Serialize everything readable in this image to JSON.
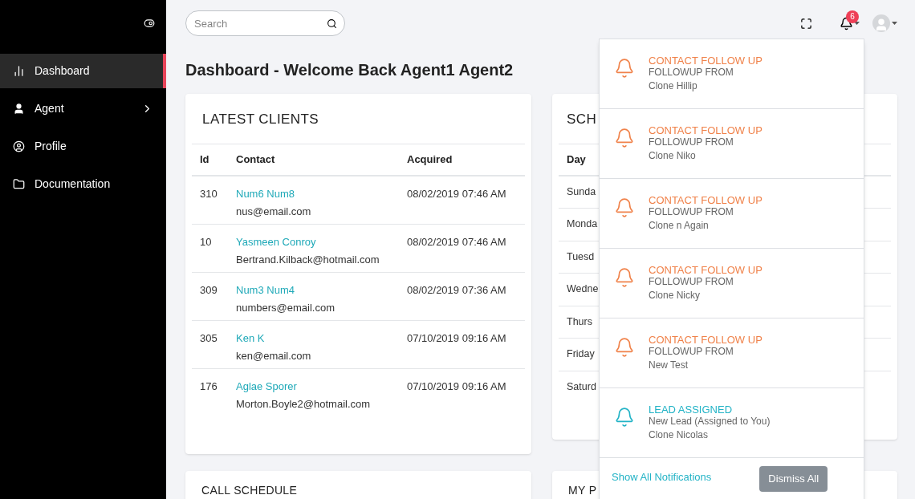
{
  "sidebar": {
    "items": [
      {
        "label": "Dashboard",
        "selected": true,
        "has_children": false
      },
      {
        "label": "Agent",
        "selected": false,
        "has_children": true
      },
      {
        "label": "Profile",
        "selected": false,
        "has_children": false
      },
      {
        "label": "Documentation",
        "selected": false,
        "has_children": false
      }
    ]
  },
  "header": {
    "search": {
      "placeholder": "Search"
    },
    "notification_count": "6"
  },
  "page_title": "Dashboard - Welcome Back Agent1 Agent2",
  "latest_clients": {
    "title": "LATEST CLIENTS",
    "columns": [
      "Id",
      "Contact",
      "Acquired"
    ],
    "rows": [
      {
        "id": "310",
        "name": "Num6 Num8",
        "email": "nus@email.com",
        "acquired": "08/02/2019 07:46 AM"
      },
      {
        "id": "10",
        "name": "Yasmeen Conroy",
        "email": "Bertrand.Kilback@hotmail.com",
        "acquired": "08/02/2019 07:46 AM"
      },
      {
        "id": "309",
        "name": "Num3 Num4",
        "email": "numbers@email.com",
        "acquired": "08/02/2019 07:36 AM"
      },
      {
        "id": "305",
        "name": "Ken K",
        "email": "ken@email.com",
        "acquired": "07/10/2019 09:16 AM"
      },
      {
        "id": "176",
        "name": "Aglae Sporer",
        "email": "Morton.Boyle2@hotmail.com",
        "acquired": "07/10/2019 09:16 AM"
      }
    ]
  },
  "schedule": {
    "title": "SCH",
    "columns": [
      "Day"
    ],
    "rows": [
      "Sunda",
      "Monda",
      "Tuesd",
      "Wedne",
      "Thurs",
      "Friday",
      "Saturd"
    ]
  },
  "bottom_cards": [
    {
      "title": "CALL SCHEDULE"
    },
    {
      "title": "MY P"
    }
  ],
  "notifications": {
    "items": [
      {
        "kind": "followup",
        "title": "CONTACT FOLLOW UP",
        "subtitle": "FOLLOWUP FROM",
        "name": "Clone Hillip"
      },
      {
        "kind": "followup",
        "title": "CONTACT FOLLOW UP",
        "subtitle": "FOLLOWUP FROM",
        "name": "Clone Niko"
      },
      {
        "kind": "followup",
        "title": "CONTACT FOLLOW UP",
        "subtitle": "FOLLOWUP FROM",
        "name": "Clone n Again"
      },
      {
        "kind": "followup",
        "title": "CONTACT FOLLOW UP",
        "subtitle": "FOLLOWUP FROM",
        "name": "Clone Nicky"
      },
      {
        "kind": "followup",
        "title": "CONTACT FOLLOW UP",
        "subtitle": "FOLLOWUP FROM",
        "name": "New Test"
      },
      {
        "kind": "lead",
        "title": "LEAD ASSIGNED",
        "subtitle": "New Lead (Assigned to You)",
        "name": "Clone Nicolas"
      }
    ],
    "show_all": "Show All Notifications",
    "dismiss": "Dismiss All"
  }
}
